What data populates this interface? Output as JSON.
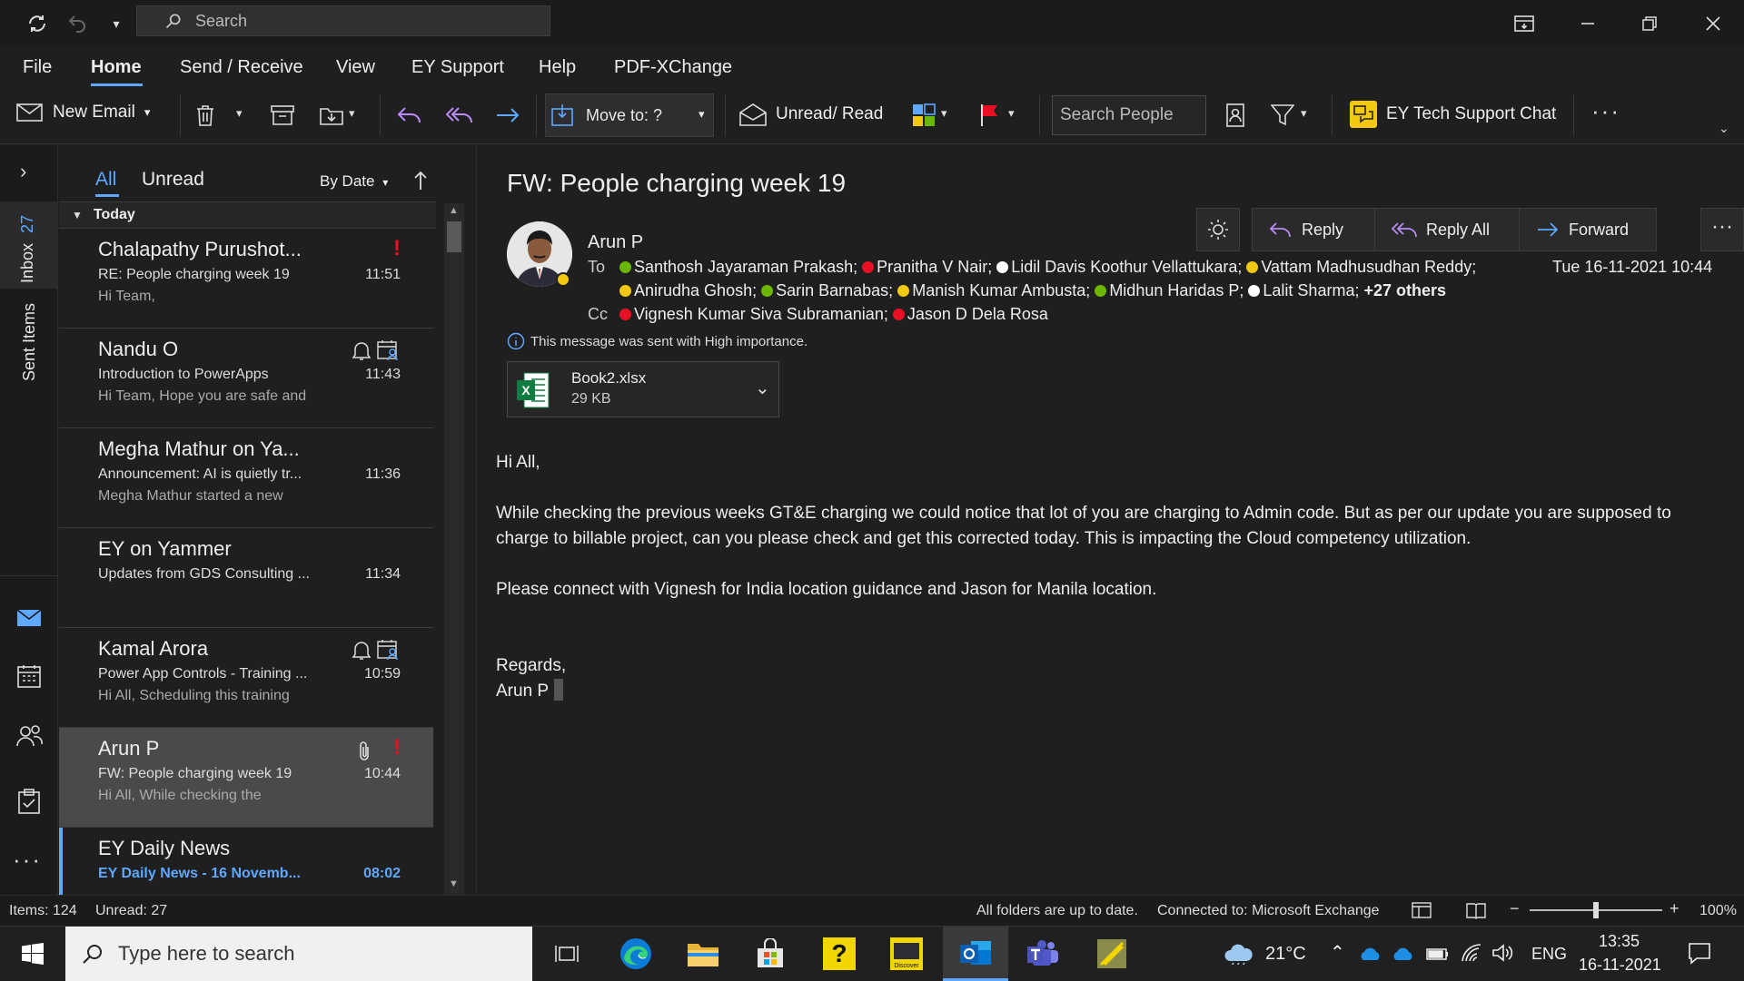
{
  "titlebar": {
    "search_placeholder": "Search"
  },
  "menu": [
    "File",
    "Home",
    "Send / Receive",
    "View",
    "EY Support",
    "Help",
    "PDF-XChange"
  ],
  "ribbon": {
    "new_email": "New Email",
    "move_to": "Move to: ?",
    "unread_read": "Unread/ Read",
    "search_people": "Search People",
    "tech_chat": "EY Tech Support Chat"
  },
  "sidebar": {
    "inbox": "Inbox",
    "inbox_count": "27",
    "sent": "Sent Items"
  },
  "list": {
    "tab_all": "All",
    "tab_unread": "Unread",
    "sort": "By Date",
    "group": "Today",
    "items": [
      {
        "from": "Chalapathy Purushot...",
        "subject": "RE: People charging week 19",
        "preview": "Hi Team,",
        "time": "11:51"
      },
      {
        "from": "Nandu O",
        "subject": "Introduction to PowerApps",
        "preview": "Hi Team,  Hope you are safe and",
        "time": "11:43"
      },
      {
        "from": "Megha Mathur on Ya...",
        "subject": "Announcement: AI is quietly tr...",
        "preview": "Megha Mathur started a new",
        "time": "11:36"
      },
      {
        "from": "EY on Yammer",
        "subject": "Updates from GDS Consulting ...",
        "preview": "",
        "time": "11:34"
      },
      {
        "from": "Kamal Arora",
        "subject": "Power App Controls - Training ...",
        "preview": "Hi All,  Scheduling this training",
        "time": "10:59"
      },
      {
        "from": "Arun P",
        "subject": "FW: People charging week 19",
        "preview": "Hi All,  While checking the",
        "time": "10:44"
      },
      {
        "from": "EY Daily News",
        "subject": "EY Daily News - 16 Novemb...",
        "preview": "",
        "time": "08:02"
      }
    ]
  },
  "message": {
    "title": "FW: People charging week 19",
    "sender": "Arun P",
    "to_label": "To",
    "cc_label": "Cc",
    "date": "Tue 16-11-2021 10:44",
    "reply": "Reply",
    "reply_all": "Reply All",
    "forward": "Forward",
    "to_line1": [
      {
        "name": "Santhosh Jayaraman Prakash;",
        "status": "#6bb700"
      },
      {
        "name": "Pranitha V Nair;",
        "status": "#e81123"
      },
      {
        "name": "Lidil Davis Koothur Vellattukara;",
        "status": "#ffffff"
      },
      {
        "name": "Vattam Madhusudhan Reddy;",
        "status": "#f2c811"
      }
    ],
    "to_line2": [
      {
        "name": "Anirudha Ghosh;",
        "status": "#f2c811"
      },
      {
        "name": "Sarin Barnabas;",
        "status": "#6bb700"
      },
      {
        "name": "Manish Kumar Ambusta;",
        "status": "#f2c811"
      },
      {
        "name": "Midhun Haridas P;",
        "status": "#6bb700"
      },
      {
        "name": "Lalit Sharma;",
        "status": "#ffffff"
      }
    ],
    "others": "+27 others",
    "cc": [
      {
        "name": "Vignesh Kumar Siva Subramanian;",
        "status": "#e81123"
      },
      {
        "name": "Jason D Dela Rosa",
        "status": "#e81123"
      }
    ],
    "importance": "This message was sent with High importance.",
    "attachment_name": "Book2.xlsx",
    "attachment_size": "29 KB",
    "body_greeting": "Hi All,",
    "body_p1": "While checking the previous weeks GT&E charging we could notice that lot of you are charging to Admin code. But as per our update you are supposed to charge to billable project, can you please check and get this corrected today. This is impacting the Cloud competency utilization.",
    "body_p2": "Please connect with Vignesh for India location guidance and Jason for Manila location.",
    "body_regards": "Regards,",
    "body_sign": "Arun P"
  },
  "status": {
    "items": "Items: 124",
    "unread": "Unread: 27",
    "sync": "All folders are up to date.",
    "connected": "Connected to: Microsoft Exchange",
    "zoom": "100%"
  },
  "taskbar": {
    "search_placeholder": "Type here to search",
    "temp": "21°C",
    "lang": "ENG",
    "time": "13:35",
    "date": "16-11-2021"
  }
}
